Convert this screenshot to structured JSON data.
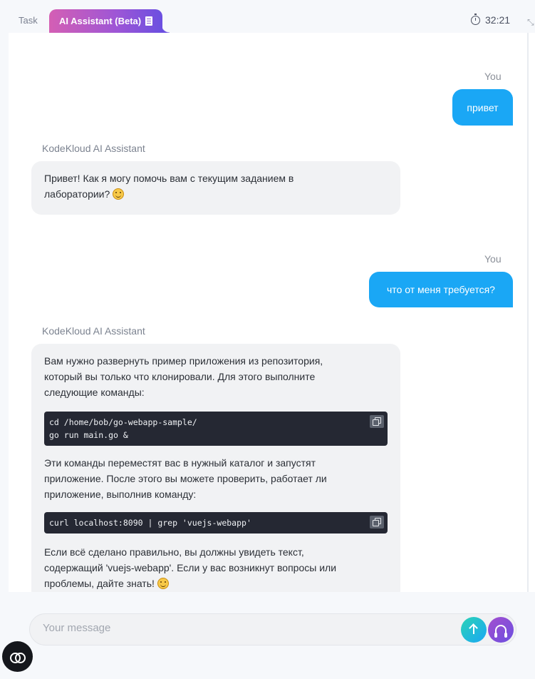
{
  "tabs": {
    "task_label": "Task",
    "ai_label": "AI Assistant (Beta)"
  },
  "timer": "32:21",
  "messages": [
    {
      "role": "user",
      "label": "You",
      "text": "привет"
    },
    {
      "role": "assistant",
      "label": "KodeKloud AI Assistant",
      "line1": "Привет! Как я могу помочь вам с текущим заданием в",
      "line2": "лаборатории?"
    },
    {
      "role": "user",
      "label": "You",
      "text": "что от меня требуется?"
    },
    {
      "role": "assistant",
      "label": "KodeKloud AI Assistant",
      "para1": [
        "Вам нужно развернуть пример приложения из репозитория,",
        "который вы только что клонировали. Для этого выполните",
        "следующие команды:"
      ],
      "code1": [
        "cd /home/bob/go-webapp-sample/",
        "go run main.go &"
      ],
      "para2": [
        "Эти команды переместят вас в нужный каталог и запустят",
        "приложение. После этого вы можете проверить, работает ли",
        "приложение, выполнив команду:"
      ],
      "code2": [
        "curl localhost:8090 | grep 'vuejs-webapp'"
      ],
      "para3": [
        "Если всё сделано правильно, вы должны увидеть текст,",
        "содержащий 'vuejs-webapp'. Если у вас возникнут вопросы или",
        "проблемы, дайте знать!"
      ]
    }
  ],
  "input": {
    "placeholder": "Your message",
    "value": ""
  },
  "icons": {
    "timer": "stopwatch-icon",
    "tab_ai": "document-icon",
    "expand": "expand-icon",
    "send": "arrow-up-icon",
    "voice": "headset-icon",
    "fab": "link-icon",
    "copy": "copy-icon",
    "emoji": "smiley-emoji"
  },
  "colors": {
    "user_bubble": "#1aa7f5",
    "ai_bubble": "#f1f2f4",
    "tab_gradient_start": "#d45fb4",
    "tab_gradient_end": "#6b4fe0",
    "code_bg": "#252833"
  }
}
